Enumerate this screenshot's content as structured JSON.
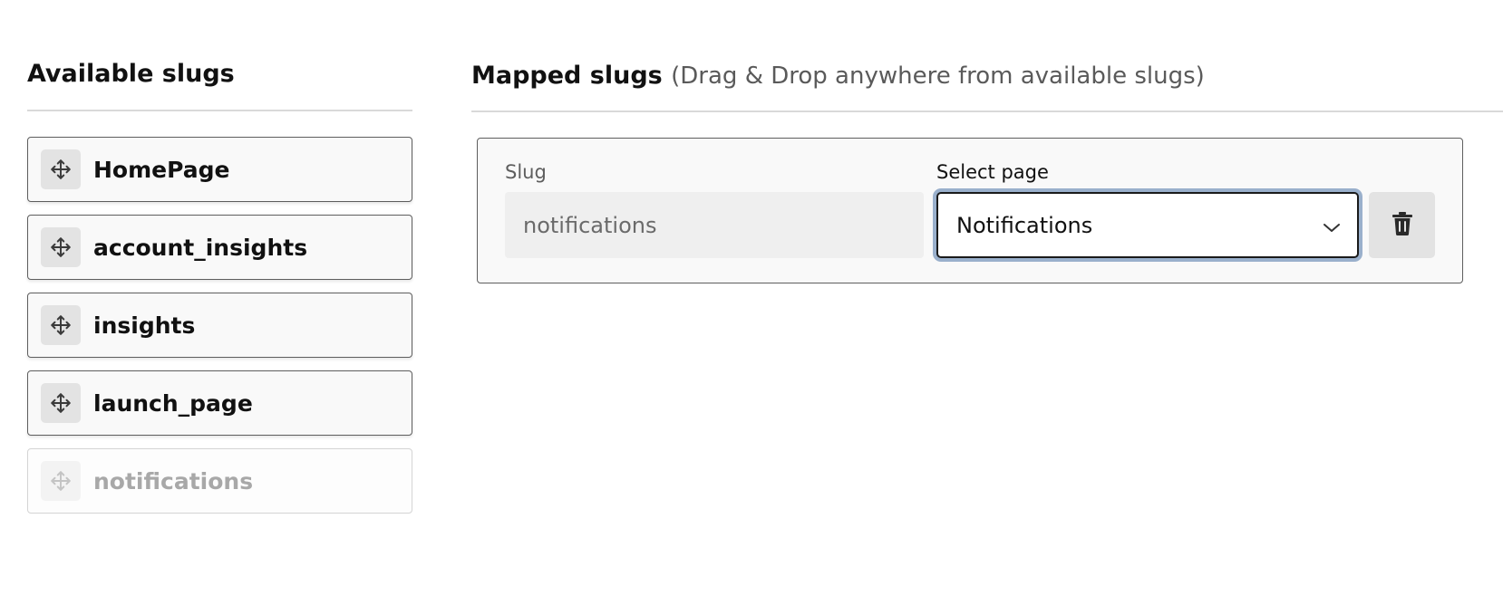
{
  "available": {
    "title": "Available slugs",
    "items": [
      {
        "label": "HomePage",
        "disabled": false
      },
      {
        "label": "account_insights",
        "disabled": false
      },
      {
        "label": "insights",
        "disabled": false
      },
      {
        "label": "launch_page",
        "disabled": false
      },
      {
        "label": "notifications",
        "disabled": true
      }
    ],
    "icon": "drag-move-icon"
  },
  "mapped": {
    "title": "Mapped slugs",
    "hint": "(Drag & Drop anywhere from available slugs)",
    "rows": [
      {
        "slug_label": "Slug",
        "slug_value": "notifications",
        "page_label": "Select page",
        "page_value": "Notifications",
        "delete_icon": "trash-icon"
      }
    ]
  },
  "colors": {
    "focus_ring": "#9ab0cc",
    "card_border": "#5e5e5e",
    "disabled_text": "#a8a8a8"
  }
}
